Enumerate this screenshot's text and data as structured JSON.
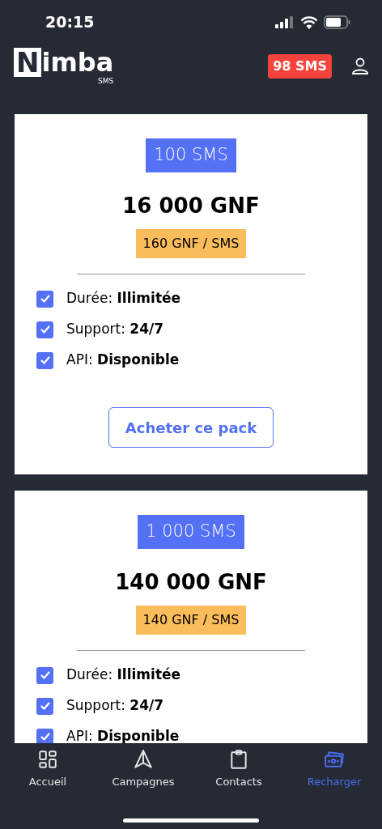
{
  "status_bar": {
    "time": "20:15"
  },
  "header": {
    "logo": {
      "letter": "N",
      "rest": "imba",
      "sub": "SMS"
    },
    "balance": "98 SMS"
  },
  "packs": [
    {
      "name": "100 SMS",
      "price": "16 000 GNF",
      "unit_price": "160 GNF / SMS",
      "features": [
        {
          "text": "Durée: **Illimitée**",
          "checked": true
        },
        {
          "text": "Support: **24/7**",
          "checked": true
        },
        {
          "text": "API: **Disponible**",
          "checked": true
        }
      ],
      "button": "Acheter ce pack"
    },
    {
      "name": "1 000 SMS",
      "price": "140 000 GNF",
      "unit_price": "140 GNF / SMS",
      "features": [
        {
          "text": "Durée: **Illimitée**",
          "checked": true
        },
        {
          "text": "Support: **24/7**",
          "checked": true
        },
        {
          "text": "API: **Disponible**",
          "checked": true
        }
      ]
    }
  ],
  "tab_bar": [
    {
      "kind": "home",
      "label": "Accueil",
      "selected": false
    },
    {
      "kind": "campaigns",
      "label": "Campagnes",
      "selected": false
    },
    {
      "kind": "contacts",
      "label": "Contacts",
      "selected": false
    },
    {
      "kind": "recharge",
      "label": "Recharger",
      "selected": true
    }
  ]
}
